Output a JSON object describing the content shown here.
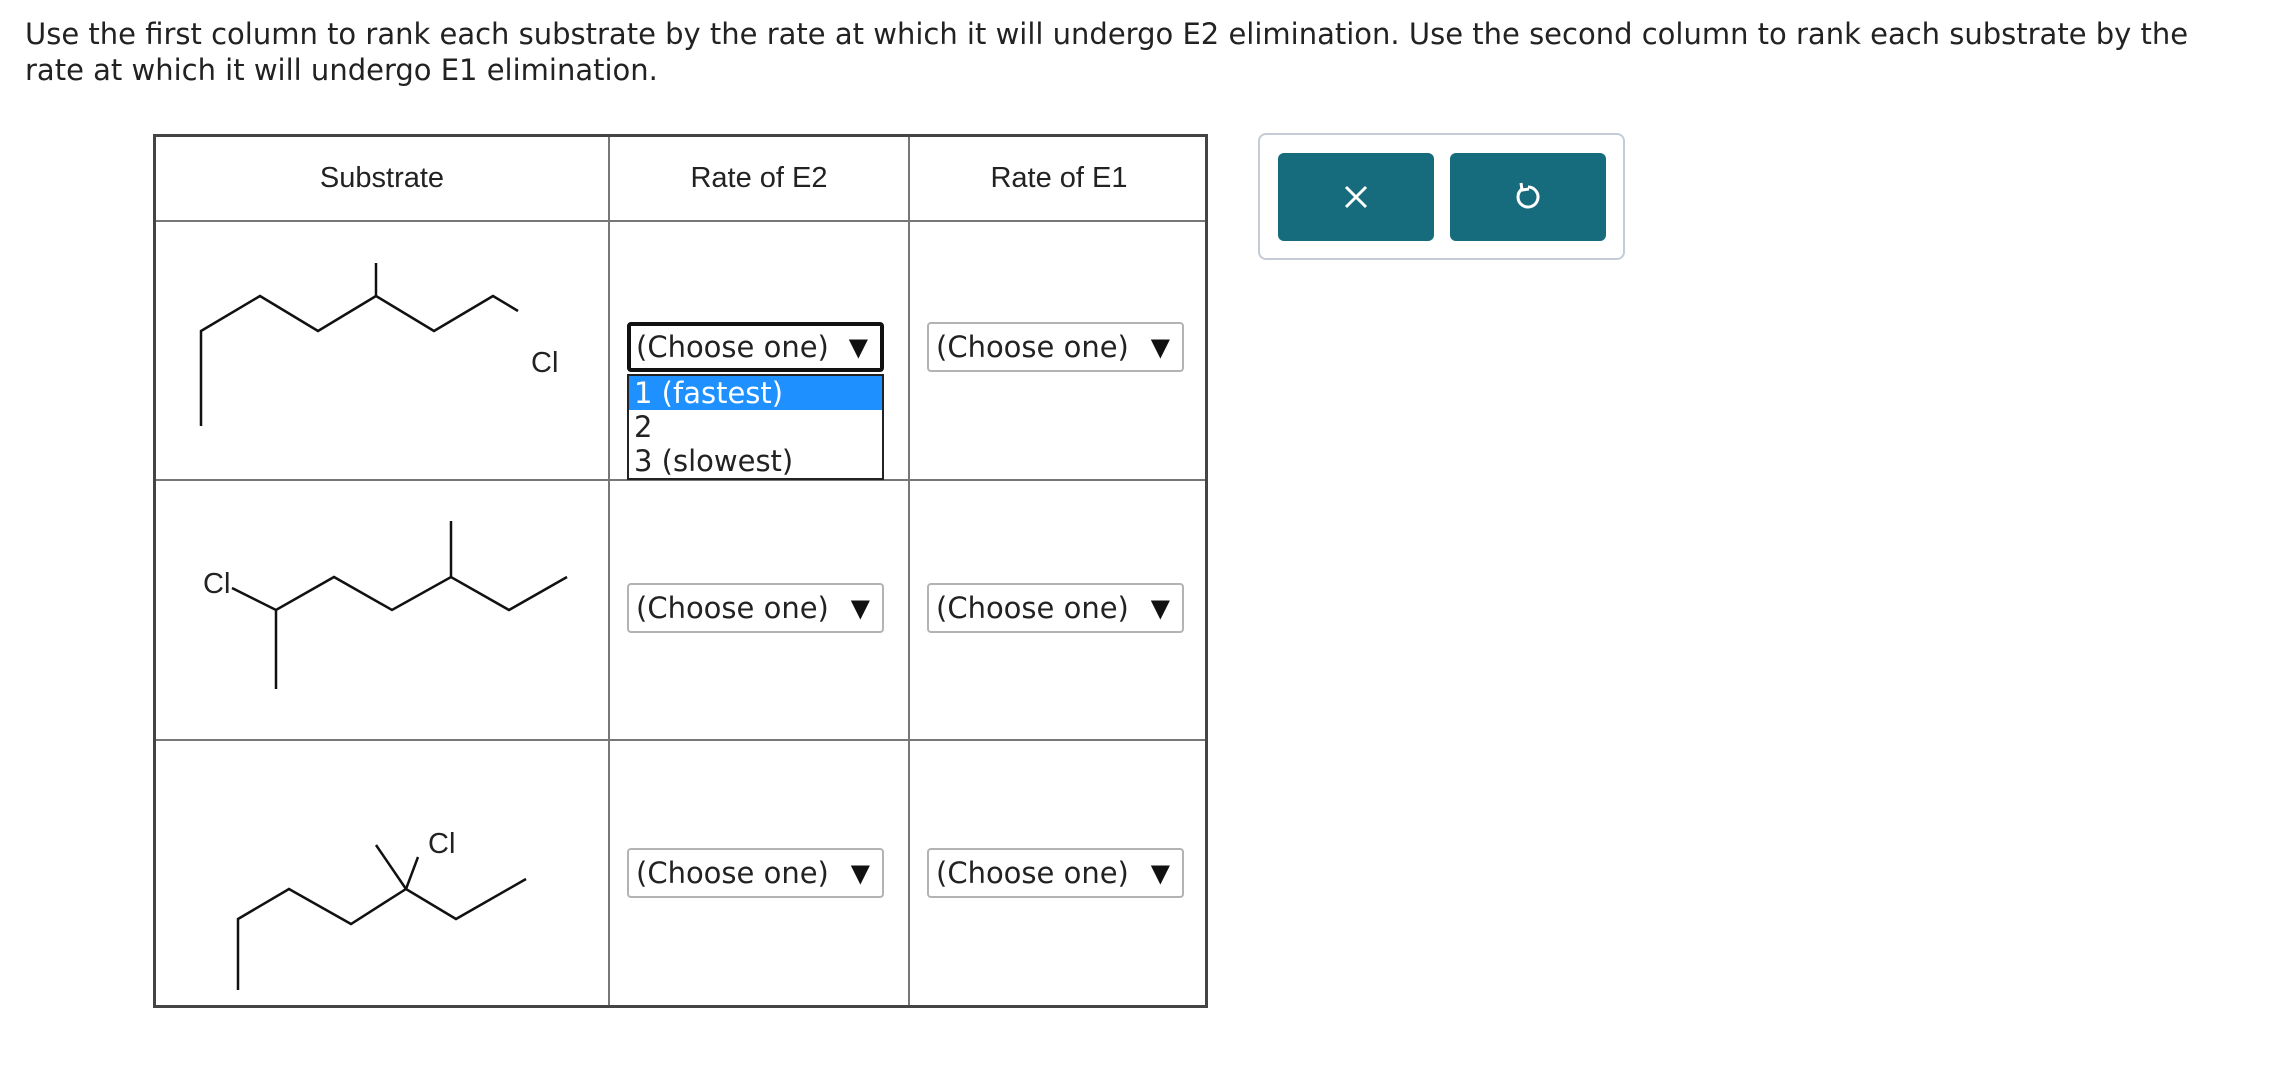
{
  "instructions": "Use the first column to rank each substrate by the rate at which it will undergo E2 elimination. Use the second column to rank each substrate by the rate at which it will undergo E1 elimination.",
  "table": {
    "headers": {
      "substrate": "Substrate",
      "e2": "Rate of E2",
      "e1": "Rate of E1"
    },
    "rows": [
      {
        "atom_label": "Cl",
        "e2_value": "(Choose one)",
        "e1_value": "(Choose one)"
      },
      {
        "atom_label": "Cl",
        "e2_value": "(Choose one)",
        "e1_value": "(Choose one)"
      },
      {
        "atom_label": "Cl",
        "e2_value": "(Choose one)",
        "e1_value": "(Choose one)"
      }
    ]
  },
  "dropdown": {
    "arrow": "▼",
    "options": [
      "1 (fastest)",
      "2",
      "3 (slowest)"
    ],
    "highlighted": "1 (fastest)"
  },
  "toolbar": {
    "clear_icon": "x-icon",
    "undo_icon": "undo-icon",
    "accent_color": "#166b7c"
  }
}
